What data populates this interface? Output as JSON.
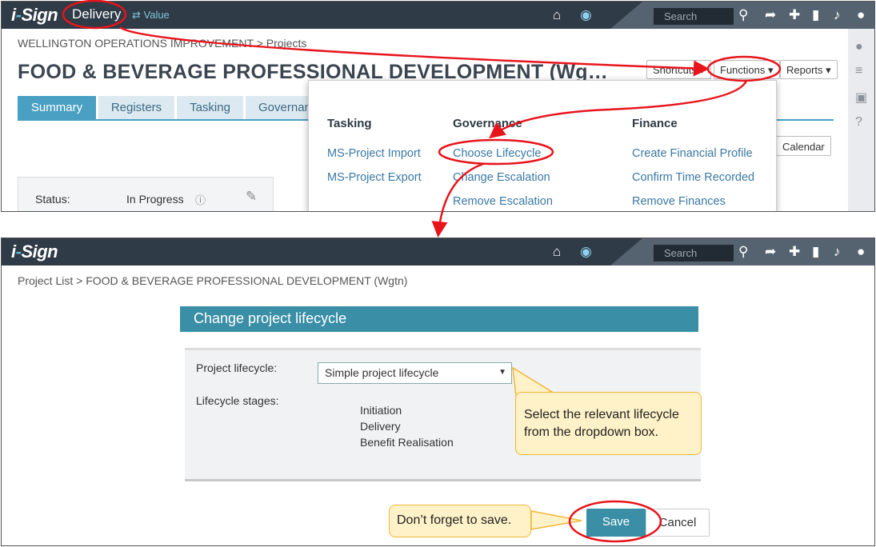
{
  "top_panel": {
    "logo": "i-Sign",
    "mode": "Delivery",
    "value_link": "⇄ Value",
    "search_placeholder": "Search",
    "breadcrumb": "WELLINGTON OPERATIONS IMPROVEMENT > Projects",
    "title": "FOOD & BEVERAGE PROFESSIONAL DEVELOPMENT (Wg…",
    "buttons": {
      "shortcuts": "Shortcuts ▾",
      "functions": "Functions ▾",
      "reports": "Reports ▾",
      "calendar": "Calendar"
    },
    "tabs": [
      "Summary",
      "Registers",
      "Tasking",
      "Governance"
    ],
    "status_label": "Status:",
    "status_value": "In Progress",
    "menu": {
      "columns": [
        {
          "heading": "Tasking",
          "items": [
            "MS-Project Import",
            "MS-Project Export"
          ]
        },
        {
          "heading": "Governance",
          "items": [
            "Choose Lifecycle",
            "Change Escalation",
            "Remove Escalation"
          ]
        },
        {
          "heading": "Finance",
          "items": [
            "Create Financial Profile",
            "Confirm Time Recorded",
            "Remove Finances"
          ]
        }
      ]
    }
  },
  "bottom_panel": {
    "logo": "i-Sign",
    "search_placeholder": "Search",
    "breadcrumb": "Project List > FOOD & BEVERAGE PROFESSIONAL DEVELOPMENT (Wgtn)",
    "dialog_title": "Change project lifecycle",
    "lifecycle_label": "Project lifecycle:",
    "lifecycle_value": "Simple project lifecycle",
    "stages_label": "Lifecycle stages:",
    "stages": [
      "Initiation",
      "Delivery",
      "Benefit Realisation"
    ],
    "save_label": "Save",
    "cancel_label": "Cancel"
  },
  "callouts": {
    "select_hint": "Select the relevant lifecycle from the dropdown box.",
    "save_hint": "Don’t forget to save."
  },
  "colors": {
    "topbar": "#2f3b46",
    "accent": "#3a8fa6",
    "tab_active": "#4aa0c2",
    "annotation": "#e8141c",
    "callout_bg": "#fff2c8"
  }
}
